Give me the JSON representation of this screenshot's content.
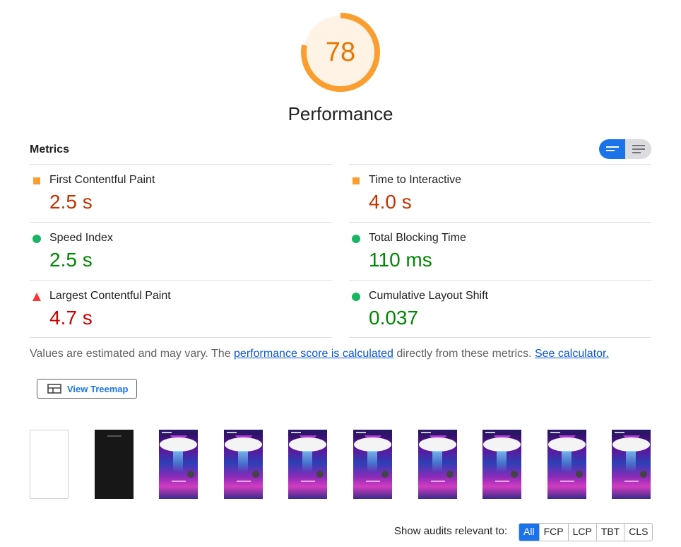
{
  "category": {
    "score": "78",
    "title": "Performance",
    "score_fraction": 0.78
  },
  "metrics": {
    "title": "Metrics",
    "toggle": {
      "compact_icon": "short-lines-icon",
      "expanded_icon": "long-lines-icon"
    },
    "items": [
      {
        "name": "First Contentful Paint",
        "value": "2.5 s",
        "rating": "average"
      },
      {
        "name": "Time to Interactive",
        "value": "4.0 s",
        "rating": "average"
      },
      {
        "name": "Speed Index",
        "value": "2.5 s",
        "rating": "pass"
      },
      {
        "name": "Total Blocking Time",
        "value": "110 ms",
        "rating": "pass"
      },
      {
        "name": "Largest Contentful Paint",
        "value": "4.7 s",
        "rating": "fail"
      },
      {
        "name": "Cumulative Layout Shift",
        "value": "0.037",
        "rating": "pass"
      }
    ]
  },
  "note": {
    "prefix": "Values are estimated and may vary. The ",
    "link1": "performance score is calculated",
    "middle": " directly from these metrics. ",
    "link2": "See calculator."
  },
  "treemap_button": {
    "label": "View Treemap",
    "icon": "treemap-icon"
  },
  "filmstrip": {
    "frames": [
      "blank",
      "dark",
      "app",
      "app",
      "app",
      "app",
      "app",
      "app",
      "app",
      "app"
    ]
  },
  "audits_filter": {
    "label": "Show audits relevant to:",
    "chips": [
      "All",
      "FCP",
      "LCP",
      "TBT",
      "CLS"
    ],
    "active": "All"
  },
  "colors": {
    "average": "#fa9f2f",
    "pass": "#18b663",
    "fail": "#ff3333",
    "accent": "#1a73e8"
  }
}
